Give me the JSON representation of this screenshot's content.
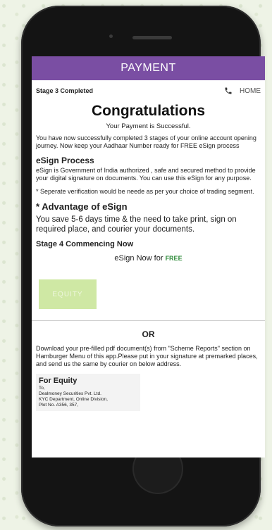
{
  "appbar": {
    "title": "PAYMENT"
  },
  "stage": {
    "status": "Stage 3 Completed",
    "home_label": "HOME"
  },
  "congrats": {
    "title": "Congratulations",
    "subtitle": "Your Payment is Successful.",
    "message": "You have now successfully completed 3 stages of your online account opening journey. Now keep your Aadhaar Number ready for FREE eSign process"
  },
  "esign_process": {
    "heading": "eSign Process",
    "text": "eSign is Government of India authorized , safe and secured method to provide your digital signature on documents. You can use this eSign for any purpose.",
    "note": "* Seperate verification would be neede as per your choice of trading segment."
  },
  "advantage": {
    "heading": "* Advantage of eSign",
    "text": "You save 5-6 days time & the need to take print, sign on required place, and courier your documents."
  },
  "stage4": {
    "heading": "Stage 4 Commencing Now",
    "esign_now": "eSign Now for",
    "free": "FREE"
  },
  "equity_button": {
    "label": "EQUITY"
  },
  "or_separator": "OR",
  "download_text": "Download your pre-filled pdf document(s) from \"Scheme Reports\" section on Hamburger Menu of this app.Please put in your signature at premarked places, and send us the same by courier on below address.",
  "equity_address": {
    "title": "For Equity",
    "lines": [
      "To,",
      "Dealmoney Securities Pvt. Ltd.",
      "KYC Department, Online Division,",
      "Plot No. A356, 357,"
    ]
  },
  "colors": {
    "appbar": "#7a4ea3",
    "free": "#2e8b3a",
    "equity_button": "#cfe8a4"
  }
}
